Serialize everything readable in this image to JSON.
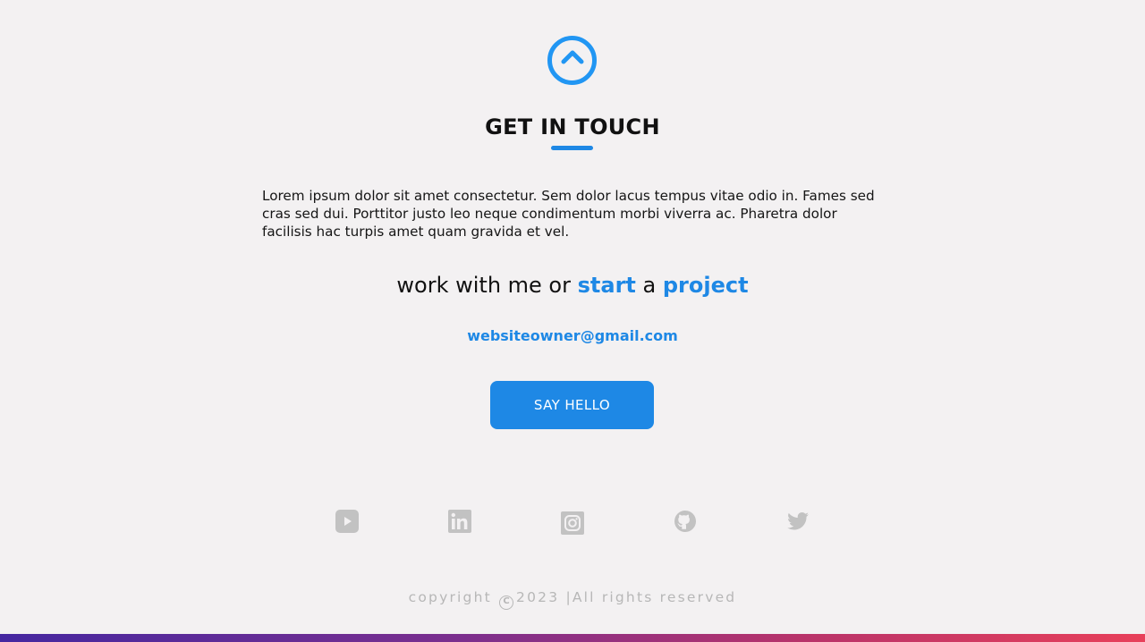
{
  "scroll_top": {
    "icon": "chevron-up-icon",
    "color": "#2196f3"
  },
  "contact": {
    "title": "GET IN TOUCH",
    "intro": "Lorem ipsum dolor sit amet consectetur. Sem dolor lacus tempus vitae odio in. Fames sed cras sed dui. Porttitor justo leo neque condimentum morbi viverra ac. Pharetra dolor facilisis hac turpis amet quam gravida et vel.",
    "tagline": {
      "part1": "work with me or ",
      "accent1": "start",
      "part2": " a ",
      "accent2": "project"
    },
    "email": "websiteowner@gmail.com",
    "cta_label": "SAY HELLO"
  },
  "social": [
    {
      "name": "youtube",
      "icon": "youtube-icon"
    },
    {
      "name": "linkedin",
      "icon": "linkedin-icon"
    },
    {
      "name": "instagram",
      "icon": "instagram-icon"
    },
    {
      "name": "github",
      "icon": "github-icon"
    },
    {
      "name": "twitter",
      "icon": "twitter-icon"
    }
  ],
  "footer": {
    "copyright_prefix": "copyright",
    "copyright_symbol": "C",
    "year": "2023",
    "separator": "|",
    "rights": "All rights reserved"
  },
  "colors": {
    "accent": "#1e88e5",
    "background": "#f3f1f2",
    "muted": "#b7b7b7",
    "gradient_start": "#4527a0",
    "gradient_end": "#e8405a"
  }
}
